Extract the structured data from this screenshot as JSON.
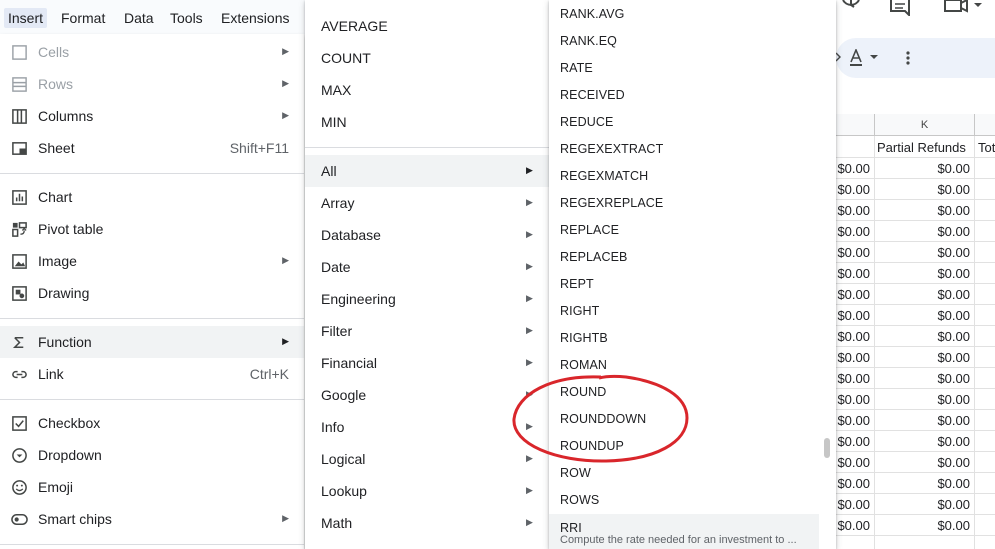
{
  "menubar": {
    "items": [
      {
        "label": "Insert",
        "active": true
      },
      {
        "label": "Format"
      },
      {
        "label": "Data"
      },
      {
        "label": "Tools"
      },
      {
        "label": "Extensions"
      }
    ]
  },
  "insert_menu": {
    "cells": "Cells",
    "rows": "Rows",
    "columns": "Columns",
    "sheet": "Sheet",
    "sheet_shortcut": "Shift+F11",
    "chart": "Chart",
    "pivot_table": "Pivot table",
    "image": "Image",
    "drawing": "Drawing",
    "function": "Function",
    "link": "Link",
    "link_shortcut": "Ctrl+K",
    "checkbox": "Checkbox",
    "dropdown": "Dropdown",
    "emoji": "Emoji",
    "smart_chips": "Smart chips"
  },
  "function_menu": {
    "quick": [
      "AVERAGE",
      "COUNT",
      "MAX",
      "MIN"
    ],
    "categories": [
      "All",
      "Array",
      "Database",
      "Date",
      "Engineering",
      "Filter",
      "Financial",
      "Google",
      "Info",
      "Logical",
      "Lookup",
      "Math"
    ]
  },
  "all_functions": {
    "items": [
      "RANK.AVG",
      "RANK.EQ",
      "RATE",
      "RECEIVED",
      "REDUCE",
      "REGEXEXTRACT",
      "REGEXMATCH",
      "REGEXREPLACE",
      "REPLACE",
      "REPLACEB",
      "REPT",
      "RIGHT",
      "RIGHTB",
      "ROMAN",
      "ROUND",
      "ROUNDDOWN",
      "ROUNDUP",
      "ROW",
      "ROWS"
    ],
    "highlighted": {
      "name": "RRI",
      "description": "Compute the rate needed for an investment to ..."
    }
  },
  "sheet": {
    "column_letter": "K",
    "header_k": "Partial Refunds",
    "header_next": "Tot",
    "value": "$0.00",
    "row_count": 18
  },
  "colors": {
    "annotation": "#d9262b",
    "menu_highlight": "#f1f3f4",
    "toolbar": "#edf2fa"
  }
}
